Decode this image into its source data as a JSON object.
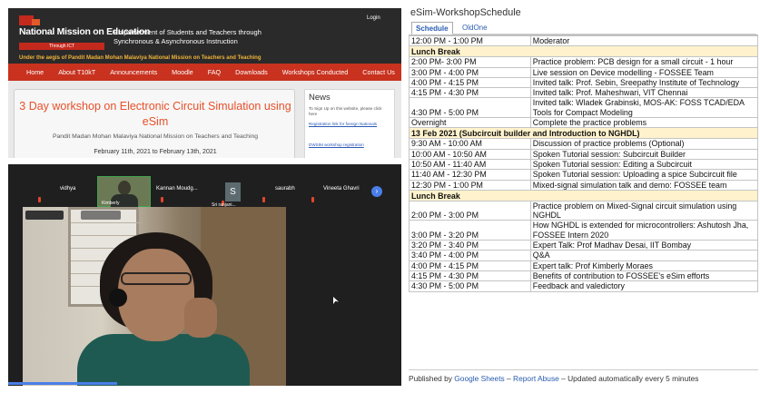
{
  "website": {
    "title": "National Mission on Education",
    "title_sub": "Through ICT",
    "subtitle_line1": "Empowerment of Students and Teachers through",
    "subtitle_line2": "Synchronous & Asynchronous Instruction",
    "login": "Login",
    "aegis": "Under the aegis of Pandit Madan Mohan Malaviya National Mission on Teachers and Teaching",
    "nav": [
      "Home",
      "About T10kT",
      "Announcements",
      "Moodle",
      "FAQ",
      "Downloads",
      "Workshops Conducted",
      "Contact Us"
    ],
    "workshop_title": "3 Day workshop on Electronic Circuit Simulation using eSim",
    "workshop_subtitle": "Pandit Madan Mohan Malaviya National Mission on Teachers and Teaching",
    "workshop_dates": "February 11th, 2021 to February 13th, 2021",
    "news_heading": "News",
    "news_item1": "To Sign Up on this website, please click here",
    "news_item2": "Registration link for foreign Nationals",
    "news_item3": "DWSIM workshop registration",
    "colors": {
      "header": "#2a2a2a",
      "nav": "#c8321f",
      "title": "#e8502a"
    }
  },
  "meeting": {
    "participants": [
      "vidhya",
      "Kimberly",
      "Kannan  Moudg...",
      "Sri ranjani...",
      "saurabh",
      "Vineeta  Ghavri"
    ],
    "avatar_letter": "S",
    "next_icon": "chevron-right-icon"
  },
  "sheet": {
    "title": "eSim-WorkshopSchedule",
    "tabs": [
      "Schedule",
      "OldOne"
    ],
    "rows": [
      {
        "time": "12:00 PM - 1:00 PM",
        "activity": "Moderator",
        "highlight": false
      },
      {
        "time": "Lunch Break",
        "activity": "",
        "highlight": true
      },
      {
        "time": "2:00 PM- 3:00 PM",
        "activity": "Practice problem: PCB design for a small circuit - 1 hour",
        "highlight": false
      },
      {
        "time": "3:00 PM - 4:00 PM",
        "activity": "Live session on Device modelling - FOSSEE Team",
        "highlight": false
      },
      {
        "time": "4:00 PM - 4:15 PM",
        "activity": "Invited talk: Prof. Sebin, Sreepathy Institute of Technology",
        "highlight": false
      },
      {
        "time": "4:15 PM - 4:30 PM",
        "activity": "Invited talk: Prof. Maheshwari, VIT Chennai",
        "highlight": false
      },
      {
        "time": "4:30 PM - 5:00 PM",
        "activity": "Invited talk: Wladek Grabinski, MOS-AK: FOSS TCAD/EDA Tools for Compact Modeling",
        "highlight": false
      },
      {
        "time": "Overnight",
        "activity": "Complete the practice problems",
        "highlight": false
      },
      {
        "time": "13 Feb 2021 (Subcircuit builder and Introduction to NGHDL)",
        "activity": "",
        "highlight": true
      },
      {
        "time": "9:30 AM - 10:00 AM",
        "activity": "Discussion of practice problems (Optional)",
        "highlight": false
      },
      {
        "time": "10:00 AM - 10:50 AM",
        "activity": "Spoken Tutorial session: Subcircuit Builder",
        "highlight": false
      },
      {
        "time": "10:50 AM - 11:40 AM",
        "activity": "Spoken Tutorial session: Editing a Subcircuit",
        "highlight": false
      },
      {
        "time": "11:40 AM - 12:30 PM",
        "activity": "Spoken Tutorial session: Uploading a spice Subcircuit file",
        "highlight": false
      },
      {
        "time": "12:30 PM - 1:00 PM",
        "activity": "Mixed-signal simulation talk and demo: FOSSEE team",
        "highlight": false
      },
      {
        "time": "Lunch Break",
        "activity": "",
        "highlight": true
      },
      {
        "time": "2:00 PM - 3:00 PM",
        "activity": "Practice problem on Mixed-Signal circuit simulation using NGHDL",
        "highlight": false
      },
      {
        "time": "3:00 PM - 3:20 PM",
        "activity": "How NGHDL is extended for microcontrollers: Ashutosh Jha, FOSSEE Intern 2020",
        "highlight": false
      },
      {
        "time": "3:20 PM - 3:40 PM",
        "activity": "Expert Talk: Prof Madhav Desai, IIT Bombay",
        "highlight": false
      },
      {
        "time": "3:40 PM - 4:00 PM",
        "activity": "Q&A",
        "highlight": false
      },
      {
        "time": "4:00 PM - 4:15 PM",
        "activity": "Expert talk: Prof Kimberly Moraes",
        "highlight": false
      },
      {
        "time": "4:15 PM - 4:30 PM",
        "activity": "Benefits of contribution to FOSSEE's eSim efforts",
        "highlight": false
      },
      {
        "time": "4:30 PM - 5:00 PM",
        "activity": "Feedback and valedictory",
        "highlight": false
      }
    ],
    "footer_published": "Published by",
    "footer_sheets": "Google Sheets",
    "footer_dash1": "–",
    "footer_report": "Report Abuse",
    "footer_updated": "– Updated automatically every 5 minutes",
    "colors": {
      "highlight": "#fff2cc",
      "link": "#2a5db0"
    }
  }
}
